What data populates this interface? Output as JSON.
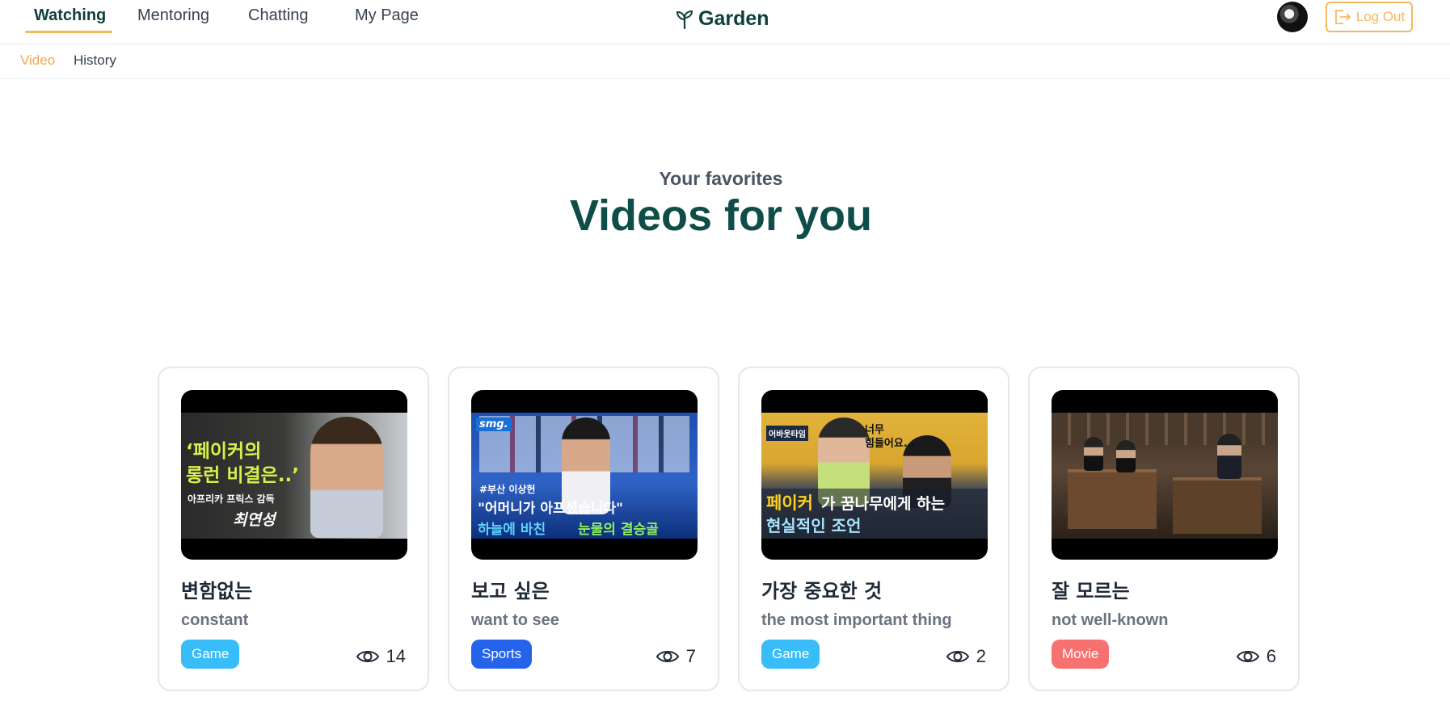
{
  "nav": {
    "items": [
      {
        "label": "Watching"
      },
      {
        "label": "Mentoring"
      },
      {
        "label": "Chatting"
      },
      {
        "label": "My Page"
      }
    ],
    "brand": "Garden",
    "logout_label": "Log Out"
  },
  "subnav": {
    "items": [
      {
        "label": "Video"
      },
      {
        "label": "History"
      }
    ]
  },
  "hero": {
    "eyebrow": "Your favorites",
    "title": "Videos for you"
  },
  "colors": {
    "accent": "#f4b860",
    "brand_dark": "#0f4d48",
    "tag_game": "#38bdf8",
    "tag_sports": "#2563eb",
    "tag_movie": "#f87171"
  },
  "cards": [
    {
      "title": "변함없는",
      "subtitle": "constant",
      "tag": "Game",
      "views": "14",
      "overlay": {
        "line1": "‘페이커의",
        "line2": "롱런 비결은..’",
        "line3": "아프리카 프릭스 감독",
        "line4": "최연성"
      }
    },
    {
      "title": "보고 싶은",
      "subtitle": "want to see",
      "tag": "Sports",
      "views": "7",
      "overlay": {
        "line0": "smg.",
        "line1": "#부산 이상헌",
        "line2": "\"어머니가 아프셨습니다\"",
        "line3": "하늘에 바친",
        "line4": "눈물의 결승골"
      }
    },
    {
      "title": "가장 중요한 것",
      "subtitle": "the most important thing",
      "tag": "Game",
      "views": "2",
      "overlay": {
        "line0": "어바웃타임",
        "line1": "너무",
        "line2": "힘들어요...",
        "line3": "페이커",
        "line4": "가 꿈나무에게 하는",
        "line5": "현실적인 조언"
      }
    },
    {
      "title": "잘 모르는",
      "subtitle": "not well-known",
      "tag": "Movie",
      "views": "6"
    }
  ]
}
